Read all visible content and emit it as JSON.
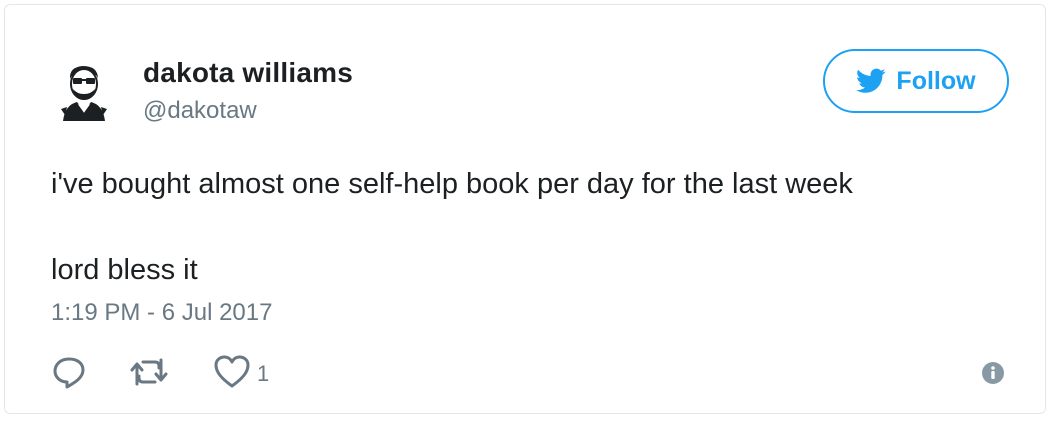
{
  "user": {
    "name": "dakota williams",
    "handle": "@dakotaw"
  },
  "follow_button": {
    "label": "Follow",
    "icon": "twitter-bird-icon"
  },
  "tweet": {
    "line1": "i've bought almost one self-help book per day for the last week",
    "line2": "lord bless it",
    "timestamp": "1:19 PM - 6 Jul 2017"
  },
  "actions": {
    "reply_icon": "reply-icon",
    "retweet_icon": "retweet-icon",
    "like_icon": "heart-icon",
    "like_count": "1",
    "info_icon": "info-icon"
  },
  "colors": {
    "accent": "#1da1f2",
    "text": "#1c2022",
    "muted": "#697882",
    "border": "#e1e8ed"
  }
}
